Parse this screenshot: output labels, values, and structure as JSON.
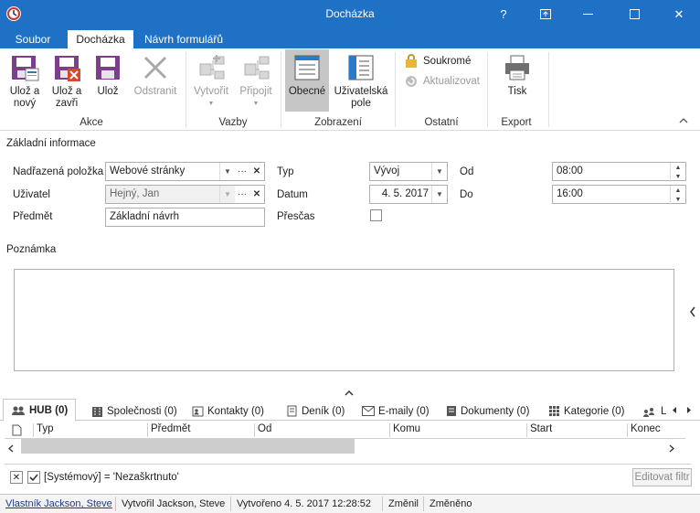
{
  "window": {
    "title": "Docházka",
    "help": "?",
    "restore": "⊡",
    "maximize": "☐",
    "close": "✕"
  },
  "tabs": [
    "Soubor",
    "Docházka",
    "Návrh formulářů"
  ],
  "ribbon": {
    "save_new": [
      "Ulož a",
      "nový"
    ],
    "save_close": [
      "Ulož a",
      "zavři"
    ],
    "save": "Ulož",
    "delete": "Odstranit",
    "create": "Vytvořit",
    "attach": "Připojit",
    "general": "Obecné",
    "user_fields": [
      "Uživatelská",
      "pole"
    ],
    "private": "Soukromé",
    "refresh": "Aktualizovat",
    "print": "Tisk",
    "groups": {
      "actions": "Akce",
      "links": "Vazby",
      "view": "Zobrazení",
      "other": "Ostatní",
      "export": "Export"
    },
    "collapse": "^"
  },
  "form": {
    "section": "Základní informace",
    "parent_label": "Nadřazená položka",
    "parent_value": "Webové stránky",
    "user_label": "Uživatel",
    "user_value": "Hejný, Jan",
    "subject_label": "Předmět",
    "subject_value": "Základní návrh",
    "type_label": "Typ",
    "type_value": "Vývoj",
    "date_label": "Datum",
    "date_value": "4. 5. 2017",
    "overtime_label": "Přesčas",
    "from_label": "Od",
    "from_value": "08:00",
    "to_label": "Do",
    "to_value": "16:00",
    "note_label": "Poznámka",
    "ellipsis": "···",
    "clear": "✕"
  },
  "bottom_tabs": [
    "HUB (0)",
    "Společnosti (0)",
    "Kontakty (0)",
    "Deník (0)",
    "E-maily (0)",
    "Dokumenty (0)",
    "Kategorie (0)",
    "L"
  ],
  "grid": {
    "columns": [
      "Typ",
      "Předmět",
      "Od",
      "Komu",
      "Start",
      "Konec"
    ]
  },
  "filter": {
    "text": "[Systémový] = 'Nezaškrtnuto'",
    "edit_button": "Editovat filtr"
  },
  "status": {
    "owner": "Vlastník Jackson, Steve",
    "created_by": "Vytvořil Jackson, Steve",
    "created": "Vytvořeno 4. 5. 2017 12:28:52",
    "changed": "Změnil",
    "modified": "Změněno"
  },
  "colors": {
    "accent": "#1e71c4",
    "delete_red": "#d9472b",
    "save_purple": "#7b3f8c"
  }
}
